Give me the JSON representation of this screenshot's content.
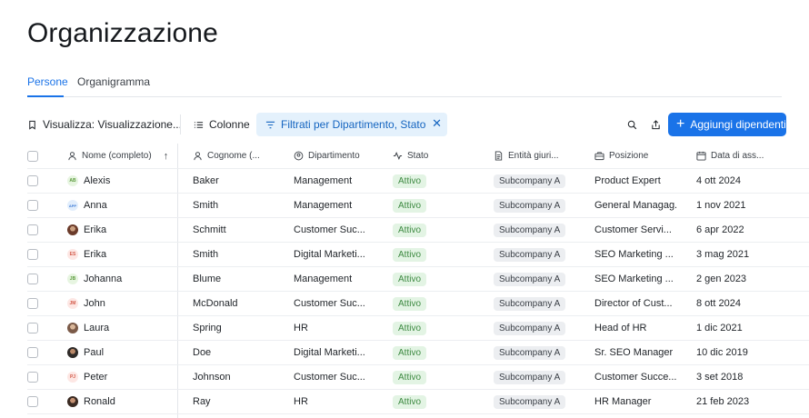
{
  "page": {
    "title": "Organizzazione"
  },
  "tabs": [
    {
      "label": "Persone",
      "active": true
    },
    {
      "label": "Organigramma",
      "active": false
    }
  ],
  "toolbar": {
    "view_label": "Visualizza: Visualizzazione...",
    "columns_label": "Colonne",
    "filter_label": "Filtrati per Dipartimento, Stato",
    "add_label": "Aggiungi dipendenti"
  },
  "columns": {
    "name": "Nome (completo)",
    "last": "Cognome (...",
    "dept": "Dipartimento",
    "stato": "Stato",
    "ent": "Entità giuri...",
    "pos": "Posizione",
    "date": "Data di ass..."
  },
  "rows": [
    {
      "initials": "AB",
      "first": "Alexis",
      "last": "Baker",
      "dept": "Management",
      "status": "Attivo",
      "entity": "Subcompany A",
      "position": "Product Expert",
      "date": "4 ott 2024"
    },
    {
      "initials": "APP",
      "first": "Anna",
      "last": "Smith",
      "dept": "Management",
      "status": "Attivo",
      "entity": "Subcompany A",
      "position": "General Managag...",
      "date": "1 nov 2021"
    },
    {
      "initials": "",
      "first": "Erika",
      "last": "Schmitt",
      "dept": "Customer Suc...",
      "status": "Attivo",
      "entity": "Subcompany A",
      "position": "Customer Servi...",
      "date": "6 apr 2022"
    },
    {
      "initials": "ES",
      "first": "Erika",
      "last": "Smith",
      "dept": "Digital Marketi...",
      "status": "Attivo",
      "entity": "Subcompany A",
      "position": "SEO Marketing ...",
      "date": "3 mag 2021"
    },
    {
      "initials": "JB",
      "first": "Johanna",
      "last": "Blume",
      "dept": "Management",
      "status": "Attivo",
      "entity": "Subcompany A",
      "position": "SEO Marketing ...",
      "date": "2 gen 2023"
    },
    {
      "initials": "JM",
      "first": "John",
      "last": "McDonald",
      "dept": "Customer Suc...",
      "status": "Attivo",
      "entity": "Subcompany A",
      "position": "Director of Cust...",
      "date": "8 ott 2024"
    },
    {
      "initials": "",
      "first": "Laura",
      "last": "Spring",
      "dept": "HR",
      "status": "Attivo",
      "entity": "Subcompany A",
      "position": "Head of HR",
      "date": "1 dic 2021"
    },
    {
      "initials": "",
      "first": "Paul",
      "last": "Doe",
      "dept": "Digital Marketi...",
      "status": "Attivo",
      "entity": "Subcompany A",
      "position": "Sr. SEO Manager",
      "date": "10 dic 2019"
    },
    {
      "initials": "PJ",
      "first": "Peter",
      "last": "Johnson",
      "dept": "Customer Suc...",
      "status": "Attivo",
      "entity": "Subcompany A",
      "position": "Customer Succe...",
      "date": "3 set 2018"
    },
    {
      "initials": "",
      "first": "Ronald",
      "last": "Ray",
      "dept": "HR",
      "status": "Attivo",
      "entity": "Subcompany A",
      "position": "HR Manager",
      "date": "21 feb 2023"
    }
  ],
  "icons": {
    "bookmark": "bookmark-icon",
    "columns": "list-icon",
    "filter": "filter-icon",
    "close": "close-icon",
    "search": "search-icon",
    "share": "share-icon",
    "add": "plus-icon"
  },
  "colors": {
    "accent": "#1a73e8",
    "filter_bg": "#e4f1fc",
    "status_bg": "#e3f4e4",
    "status_text": "#3e8a42"
  }
}
